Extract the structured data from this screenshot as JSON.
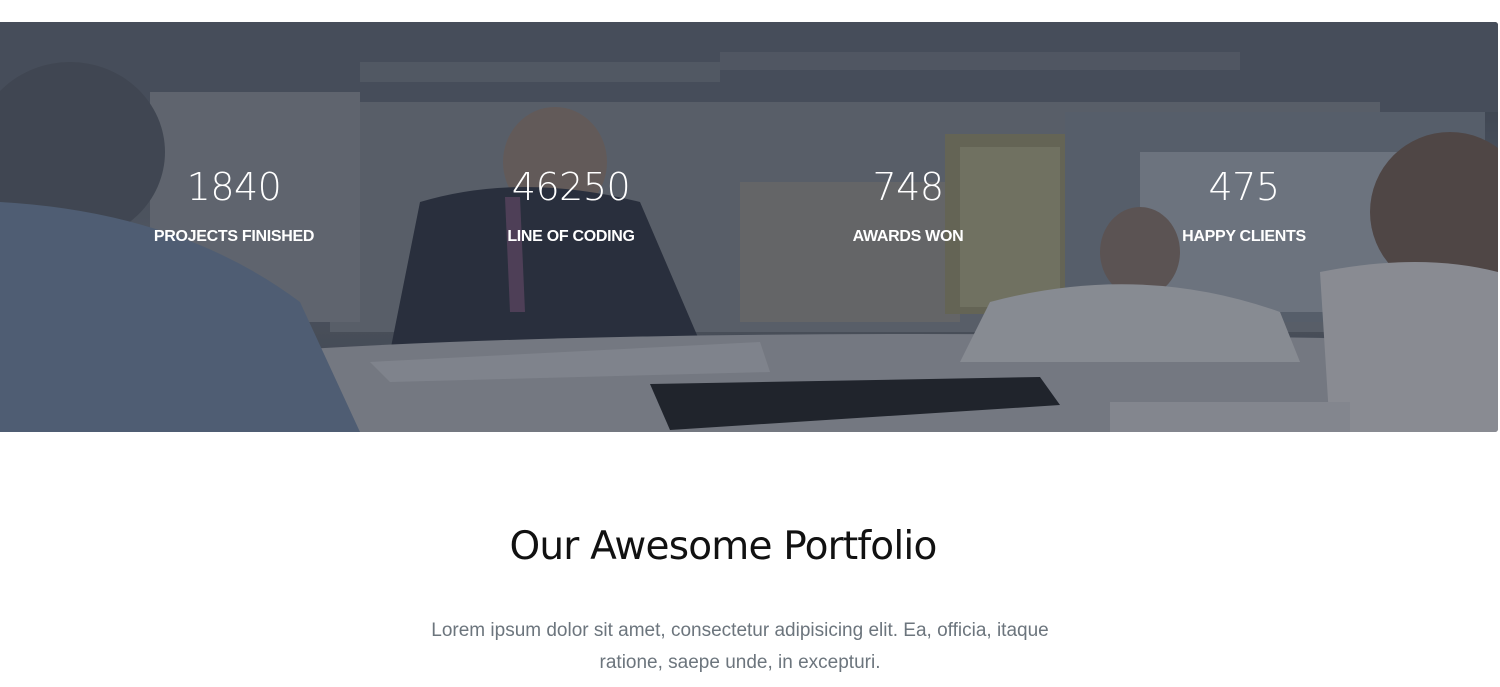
{
  "stats": [
    {
      "number": "1840",
      "label": "PROJECTS FINISHED"
    },
    {
      "number": "46250",
      "label": "LINE OF CODING"
    },
    {
      "number": "748",
      "label": "AWARDS WON"
    },
    {
      "number": "475",
      "label": "HAPPY CLIENTS"
    }
  ],
  "portfolio": {
    "title": "Our Awesome Portfolio",
    "description": "Lorem ipsum dolor sit amet, consectetur adipisicing elit. Ea, officia, itaque ratione, saepe unde, in excepturi."
  },
  "colors": {
    "overlay": "#212834",
    "stat_text": "#ffffff",
    "title_text": "#111111",
    "desc_text": "#6c757d"
  }
}
